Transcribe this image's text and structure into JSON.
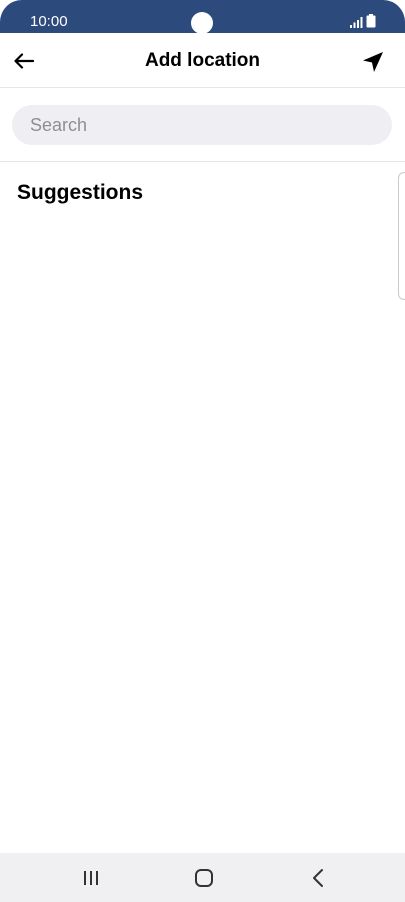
{
  "status_bar": {
    "time": "10:00",
    "icons": [
      "signal-icon",
      "battery-icon"
    ]
  },
  "app_bar": {
    "title": "Add location",
    "back_icon": "arrow-left-icon",
    "location_icon": "navigation-arrow-icon"
  },
  "search": {
    "placeholder": "Search",
    "value": ""
  },
  "suggestions": {
    "title": "Suggestions",
    "items": []
  },
  "nav_bar": {
    "icons": [
      "recent-apps-icon",
      "home-icon",
      "back-icon"
    ]
  },
  "colors": {
    "status_bar": "#2d4a7c",
    "search_bg": "#efeff3",
    "nav_bar": "#f0f0f3"
  }
}
